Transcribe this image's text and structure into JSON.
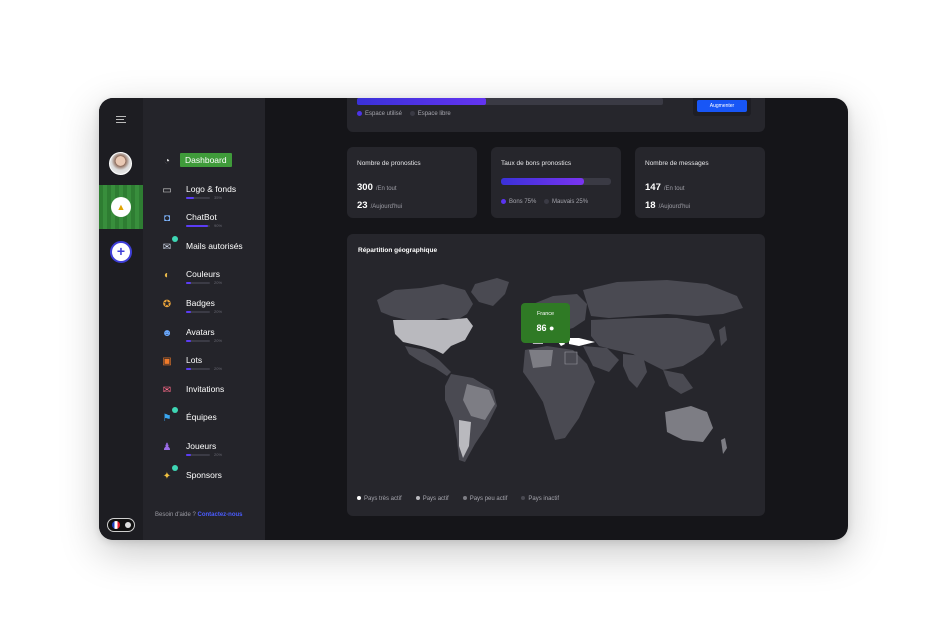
{
  "rail": {
    "lang_flag": "France"
  },
  "sidebar": {
    "items": [
      {
        "label": "Dashboard",
        "icon": "gauge-icon",
        "active": true
      },
      {
        "label": "Logo & fonds",
        "icon": "image-icon",
        "progress": 35,
        "pct_label": "35%"
      },
      {
        "label": "ChatBot",
        "icon": "robot-icon",
        "progress": 90,
        "pct_label": "90%"
      },
      {
        "label": "Mails autorisés",
        "icon": "mail-icon",
        "notif": true
      },
      {
        "label": "Couleurs",
        "icon": "palette-icon",
        "progress": 20,
        "pct_label": "20%"
      },
      {
        "label": "Badges",
        "icon": "medal-icon",
        "progress": 20,
        "pct_label": "20%"
      },
      {
        "label": "Avatars",
        "icon": "avatar-icon",
        "progress": 20,
        "pct_label": "20%"
      },
      {
        "label": "Lots",
        "icon": "gift-icon",
        "progress": 20,
        "pct_label": "20%"
      },
      {
        "label": "Invitations",
        "icon": "invitation-icon"
      },
      {
        "label": "Équipes",
        "icon": "team-icon",
        "notif": true
      },
      {
        "label": "Joueurs",
        "icon": "player-icon",
        "progress": 20,
        "pct_label": "20%"
      },
      {
        "label": "Sponsors",
        "icon": "sponsor-icon",
        "notif": true
      }
    ],
    "help_text": "Besoin d'aide ?",
    "help_link": "Contactez-nous"
  },
  "storage": {
    "used_fraction": 0.42,
    "legend_used": "Espace utilisé",
    "legend_free": "Espace libre",
    "upgrade_label": "Augmenter",
    "used_color": "#4c34e8",
    "free_color": "#3a3a44"
  },
  "stats": {
    "pronostics": {
      "title": "Nombre de pronostics",
      "total": "300",
      "total_label": "/En tout",
      "today": "23",
      "today_label": "/Aujourd'hui"
    },
    "rate": {
      "title": "Taux de bons pronostics",
      "good_fraction": 0.75,
      "good_label": "Bons 75%",
      "bad_label": "Mauvais 25%",
      "good_color": "#5a34f0"
    },
    "messages": {
      "title": "Nombre de messages",
      "total": "147",
      "total_label": "/En tout",
      "today": "18",
      "today_label": "/Aujourd'hui"
    }
  },
  "map": {
    "title": "Répartition géographique",
    "tooltip_country": "France",
    "tooltip_value": "86",
    "legend": [
      {
        "label": "Pays très actif",
        "color": "#ffffff"
      },
      {
        "label": "Pays actif",
        "color": "#b9b9be"
      },
      {
        "label": "Pays peu actif",
        "color": "#7d7d84"
      },
      {
        "label": "Pays inactif",
        "color": "#4a4a52"
      }
    ]
  }
}
